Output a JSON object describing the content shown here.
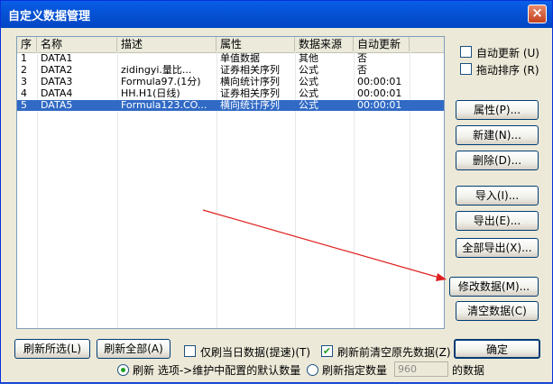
{
  "window": {
    "title": "自定义数据管理",
    "close_glyph": "×"
  },
  "table": {
    "columns": [
      "序",
      "名称",
      "描述",
      "属性",
      "数据来源",
      "自动更新"
    ],
    "rows": [
      [
        "1",
        "DATA1",
        "",
        "单值数据",
        "其他",
        "否"
      ],
      [
        "2",
        "DATA2",
        "zidingyi.量比...",
        "证券相关序列",
        "公式",
        "否"
      ],
      [
        "3",
        "DATA3",
        "Formula97.(1分)",
        "横向统计序列",
        "公式",
        "00:00:01"
      ],
      [
        "4",
        "DATA4",
        "HH.H1(日线)",
        "证券相关序列",
        "公式",
        "00:00:01"
      ],
      [
        "5",
        "DATA5",
        "Formula123.CO...",
        "横向统计序列",
        "公式",
        "00:00:01"
      ]
    ],
    "selected_row": 4
  },
  "options": {
    "auto_update": {
      "label": "自动更新 (U)",
      "checked": false
    },
    "drag_sort": {
      "label": "拖动排序 (R)",
      "checked": false
    }
  },
  "buttons": {
    "properties": "属性(P)...",
    "new": "新建(N)...",
    "delete": "删除(D)...",
    "import": "导入(I)...",
    "export": "导出(E)...",
    "export_all": "全部导出(X)...",
    "modify_data": "修改数据(M)...",
    "clear_data": "清空数据(C)",
    "refresh_selected": "刷新所选(L)",
    "refresh_all": "刷新全部(A)",
    "ok": "确定"
  },
  "bottom": {
    "today_only": {
      "label": "仅刷当日数据(提速)(T)",
      "checked": false
    },
    "clear_before": {
      "label": "刷新前清空原先数据(Z)",
      "checked": true
    },
    "radio_default": {
      "label": "刷新 选项->维护中配置的默认数量",
      "selected": true
    },
    "radio_specified": {
      "label": "刷新指定数量",
      "selected": false
    },
    "count_value": "960",
    "count_suffix": "的数据"
  },
  "colors": {
    "selection": "#316ac5",
    "title_bar": "#0553d6",
    "annotation_arrow": "#e02020"
  }
}
